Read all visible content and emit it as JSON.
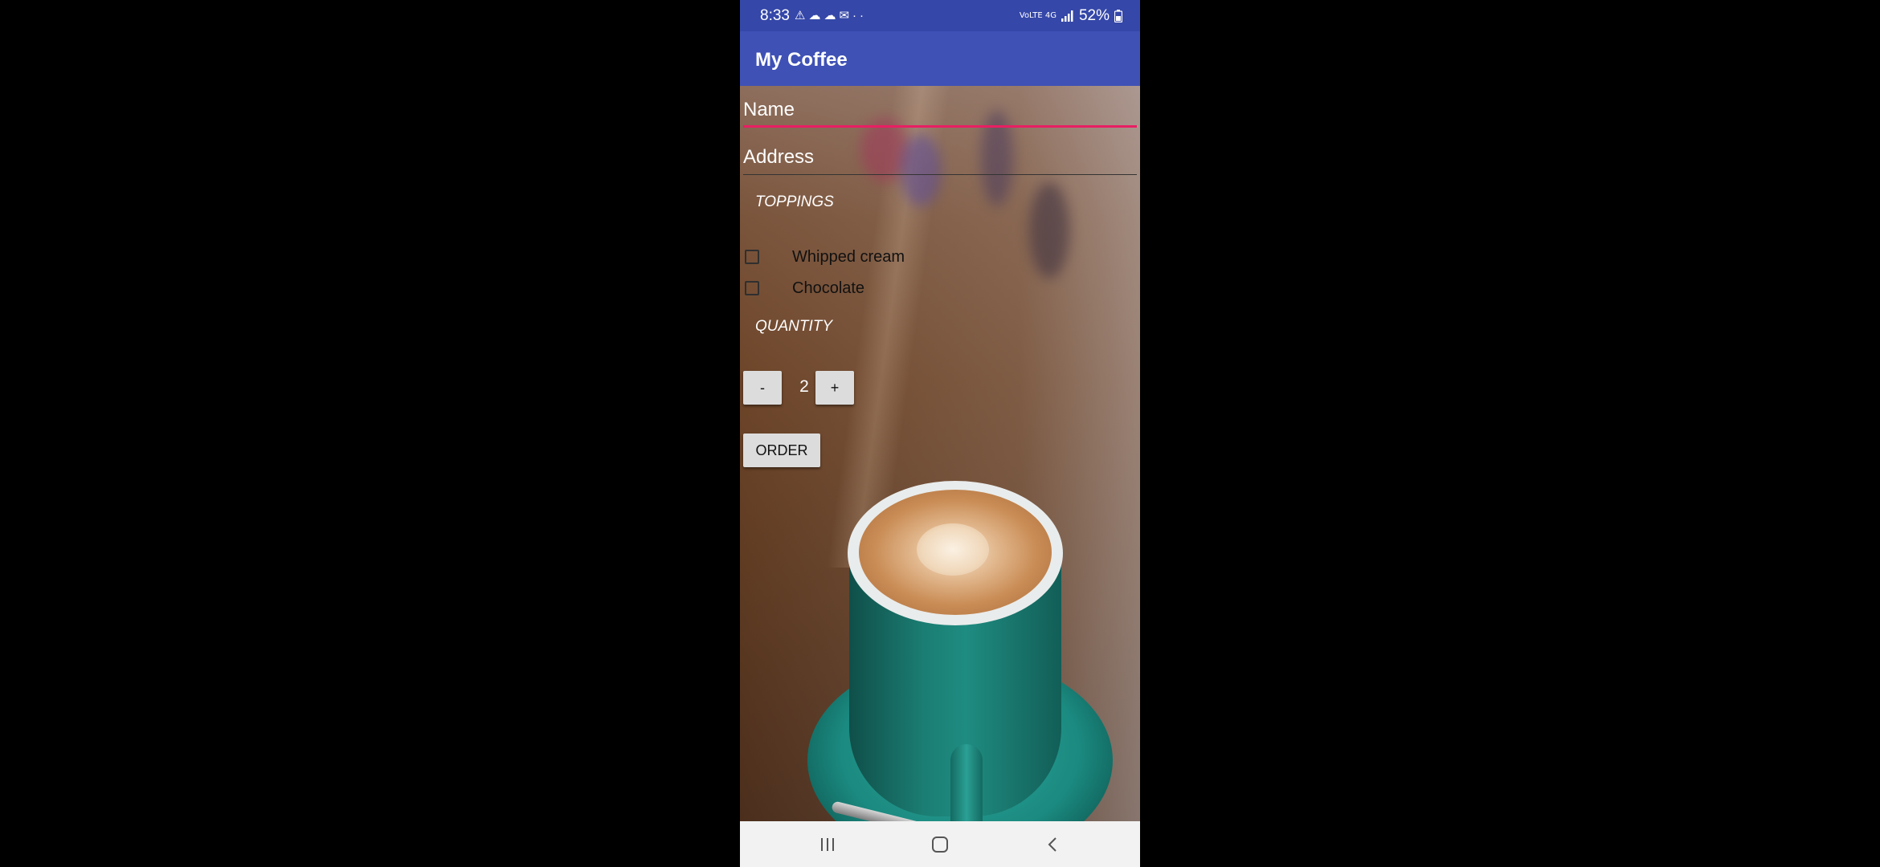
{
  "status_bar": {
    "time": "8:33",
    "left_icons": [
      "warning-icon",
      "cloud-icon",
      "cloud-icon",
      "mail-icon",
      "more-icon"
    ],
    "network": "VoLTE 4G",
    "battery": "52%"
  },
  "app_bar": {
    "title": "My Coffee"
  },
  "form": {
    "name_placeholder": "Name",
    "address_placeholder": "Address",
    "toppings_label": "TOPPINGS",
    "toppings": [
      {
        "label": "Whipped cream",
        "checked": false
      },
      {
        "label": "Chocolate",
        "checked": false
      }
    ],
    "quantity_label": "QUANTITY",
    "decrement_label": "-",
    "quantity_value": "2",
    "increment_label": "+",
    "order_label": "ORDER"
  },
  "colors": {
    "app_bar": "#3f51b5",
    "status_bar": "#3547a8",
    "accent": "#e91e63",
    "button": "#dcdcdc"
  },
  "nav_bar": {
    "buttons": [
      "recent-apps-icon",
      "home-icon",
      "back-icon"
    ]
  }
}
